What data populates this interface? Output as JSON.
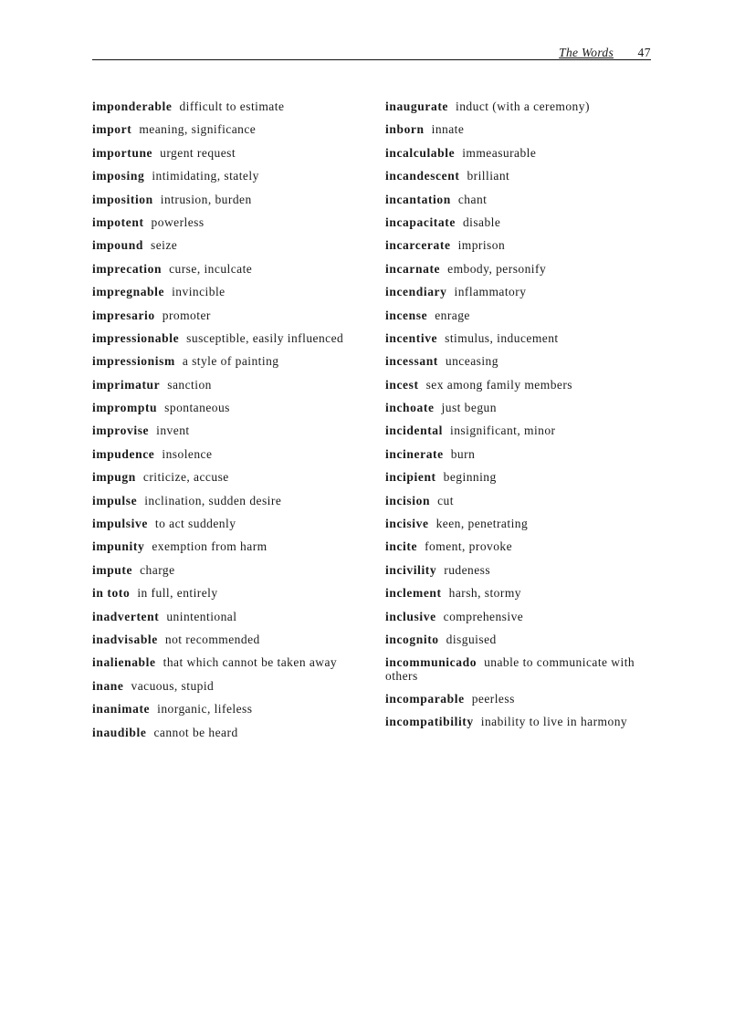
{
  "header": {
    "running_title": "The Words",
    "page_number": "47"
  },
  "columns": [
    {
      "entries": [
        {
          "term": "imponderable",
          "definition": "difficult to estimate"
        },
        {
          "term": "import",
          "definition": "meaning, significance"
        },
        {
          "term": "importune",
          "definition": "urgent request"
        },
        {
          "term": "imposing",
          "definition": "intimidating, stately"
        },
        {
          "term": "imposition",
          "definition": "intrusion, burden"
        },
        {
          "term": "impotent",
          "definition": "powerless"
        },
        {
          "term": "impound",
          "definition": "seize"
        },
        {
          "term": "imprecation",
          "definition": "curse, inculcate"
        },
        {
          "term": "impregnable",
          "definition": "invincible"
        },
        {
          "term": "impresario",
          "definition": "promoter"
        },
        {
          "term": "impressionable",
          "definition": "susceptible, easily influenced"
        },
        {
          "term": "impressionism",
          "definition": "a style of painting"
        },
        {
          "term": "imprimatur",
          "definition": "sanction"
        },
        {
          "term": "impromptu",
          "definition": "spontaneous"
        },
        {
          "term": "improvise",
          "definition": "invent"
        },
        {
          "term": "impudence",
          "definition": "insolence"
        },
        {
          "term": "impugn",
          "definition": "criticize, accuse"
        },
        {
          "term": "impulse",
          "definition": "inclination, sudden desire"
        },
        {
          "term": "impulsive",
          "definition": "to act suddenly"
        },
        {
          "term": "impunity",
          "definition": "exemption from harm"
        },
        {
          "term": "impute",
          "definition": "charge"
        },
        {
          "term": "in toto",
          "definition": "in full, entirely"
        },
        {
          "term": "inadvertent",
          "definition": "unintentional"
        },
        {
          "term": "inadvisable",
          "definition": "not recommended"
        },
        {
          "term": "inalienable",
          "definition": "that which cannot be taken away"
        },
        {
          "term": "inane",
          "definition": "vacuous, stupid"
        },
        {
          "term": "inanimate",
          "definition": "inorganic, lifeless"
        },
        {
          "term": "inaudible",
          "definition": "cannot be heard"
        }
      ]
    },
    {
      "entries": [
        {
          "term": "inaugurate",
          "definition": "induct (with a ceremony)"
        },
        {
          "term": "inborn",
          "definition": "innate"
        },
        {
          "term": "incalculable",
          "definition": "immeasurable"
        },
        {
          "term": "incandescent",
          "definition": "brilliant"
        },
        {
          "term": "incantation",
          "definition": "chant"
        },
        {
          "term": "incapacitate",
          "definition": "disable"
        },
        {
          "term": "incarcerate",
          "definition": "imprison"
        },
        {
          "term": "incarnate",
          "definition": "embody, personify"
        },
        {
          "term": "incendiary",
          "definition": "inflammatory"
        },
        {
          "term": "incense",
          "definition": "enrage"
        },
        {
          "term": "incentive",
          "definition": "stimulus, inducement"
        },
        {
          "term": "incessant",
          "definition": "unceasing"
        },
        {
          "term": "incest",
          "definition": "sex among family members"
        },
        {
          "term": "inchoate",
          "definition": "just begun"
        },
        {
          "term": "incidental",
          "definition": "insignificant, minor"
        },
        {
          "term": "incinerate",
          "definition": "burn"
        },
        {
          "term": "incipient",
          "definition": "beginning"
        },
        {
          "term": "incision",
          "definition": "cut"
        },
        {
          "term": "incisive",
          "definition": "keen, penetrating"
        },
        {
          "term": "incite",
          "definition": "foment, provoke"
        },
        {
          "term": "incivility",
          "definition": "rudeness"
        },
        {
          "term": "inclement",
          "definition": "harsh, stormy"
        },
        {
          "term": "inclusive",
          "definition": "comprehensive"
        },
        {
          "term": "incognito",
          "definition": "disguised"
        },
        {
          "term": "incommunicado",
          "definition": "unable to communicate with others"
        },
        {
          "term": "incomparable",
          "definition": "peerless"
        },
        {
          "term": "incompatibility",
          "definition": "inability to live in harmony"
        }
      ]
    }
  ]
}
